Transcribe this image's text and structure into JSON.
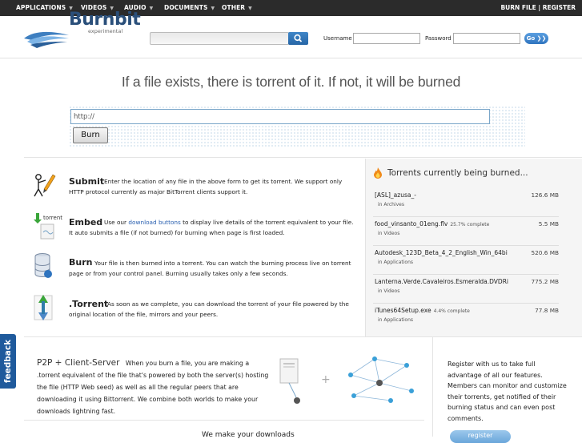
{
  "nav": {
    "items": [
      {
        "label": "APPLICATIONS"
      },
      {
        "label": "VIDEOS"
      },
      {
        "label": "AUDIO"
      },
      {
        "label": "DOCUMENTS"
      },
      {
        "label": "OTHER"
      }
    ],
    "burn_file": "BURN FILE",
    "separator": "|",
    "register": "REGISTER"
  },
  "header": {
    "logo": "Burnbit",
    "logo_sub": "experimental",
    "username_label": "Username",
    "password_label": "Password",
    "go_label": "Go ❯❯"
  },
  "hero": {
    "tagline": "If a file exists, there is torrent of it. If not, it will be burned",
    "url_value": "http://",
    "burn_button": "Burn"
  },
  "features": [
    {
      "title": "Submit",
      "text": "Enter the location of any file in the above form to get its torrent. We support only HTTP protocol currently as major BitTorrent clients support it."
    },
    {
      "title": "Embed",
      "pre": "Use our ",
      "link": "download buttons",
      "text": " to display live details of the torrent equivalent to your file. It auto submits a file (if not burned) for burning when page is first loaded.",
      "icon_label": "torrent"
    },
    {
      "title": "Burn",
      "text": "Your file is then burned into a torrent. You can watch the burning process live on torrent page or from your control panel. Burning usually takes only a few seconds."
    },
    {
      "title": ".Torrent",
      "text": "As soon as we complete, you can download the torrent of your file powered by the original location of the file, mirrors and your peers."
    }
  ],
  "torrents": {
    "title": "Torrents currently being burned...",
    "rows": [
      {
        "name": "[ASL]_azusa_-",
        "pct": "",
        "category": "in Archives",
        "size": "126.6 MB"
      },
      {
        "name": "food_vinsanto_01eng.flv",
        "pct": "25.7% complete",
        "category": "in Videos",
        "size": "5.5 MB"
      },
      {
        "name": "Autodesk_123D_Beta_4_2_English_Win_64bi",
        "pct": "",
        "category": "in Applications",
        "size": "520.6 MB"
      },
      {
        "name": "Lanterna.Verde.Cavaleiros.Esmeralda.DVDRi",
        "pct": "",
        "category": "in Videos",
        "size": "775.2 MB"
      },
      {
        "name": "iTunes64Setup.exe",
        "pct": "4.4% complete",
        "category": "in Applications",
        "size": "77.8 MB"
      }
    ]
  },
  "p2p": {
    "title": "P2P + Client-Server",
    "text": "When you burn a file, you are making a .torrent equivalent of the file that's powered by both the server(s) hosting the file (HTTP Web seed) as well as all the regular peers that are downloading it using Bittorrent. We combine both worlds to make your downloads lightning fast.",
    "plus": "+"
  },
  "register_box": {
    "text": "Register with us to take full advantage of all our features. Members can monitor and customize their torrents, get notified of their burning status and can even post comments.",
    "button": "register"
  },
  "feedback": "feedback",
  "bottom_tease": "We make your downloads"
}
